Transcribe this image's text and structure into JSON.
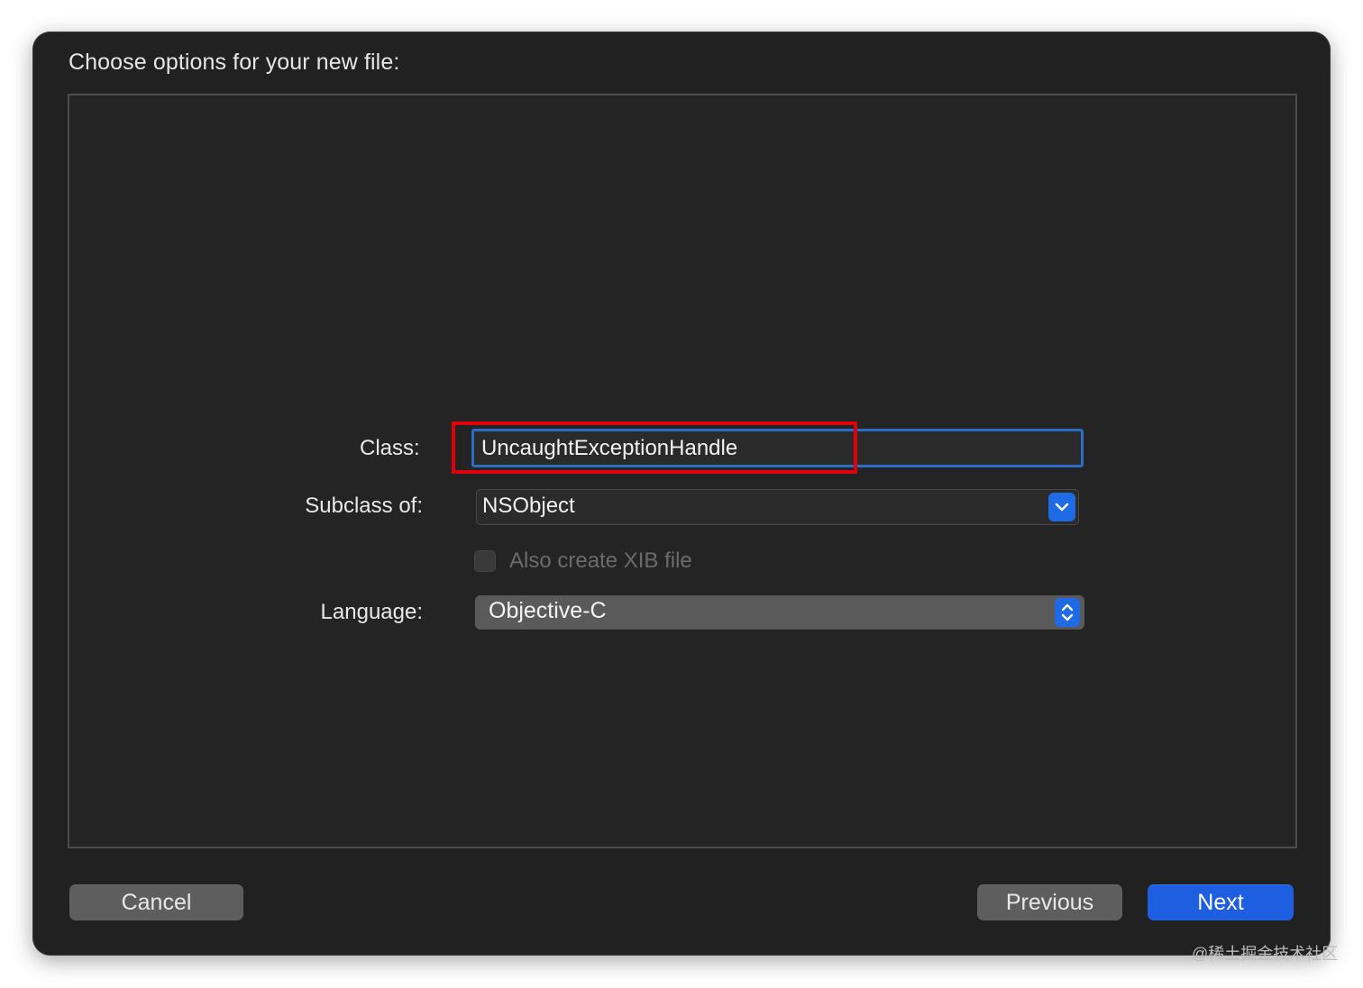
{
  "dialog": {
    "title": "Choose options for your new file:"
  },
  "form": {
    "class_label": "Class:",
    "class_value": "UncaughtExceptionHandle",
    "subclass_label": "Subclass of:",
    "subclass_value": "NSObject",
    "xib_label": "Also create XIB file",
    "xib_checked": false,
    "language_label": "Language:",
    "language_value": "Objective-C"
  },
  "buttons": {
    "cancel": "Cancel",
    "previous": "Previous",
    "next": "Next"
  },
  "watermark": "@稀土掘金技术社区",
  "colors": {
    "accent": "#1d5fe0",
    "highlight": "#e0000a",
    "focus_ring": "#2c6ec4"
  },
  "icons": {
    "subclass_dropdown": "chevron-down-icon",
    "language_popup": "chevron-up-down-icon"
  }
}
